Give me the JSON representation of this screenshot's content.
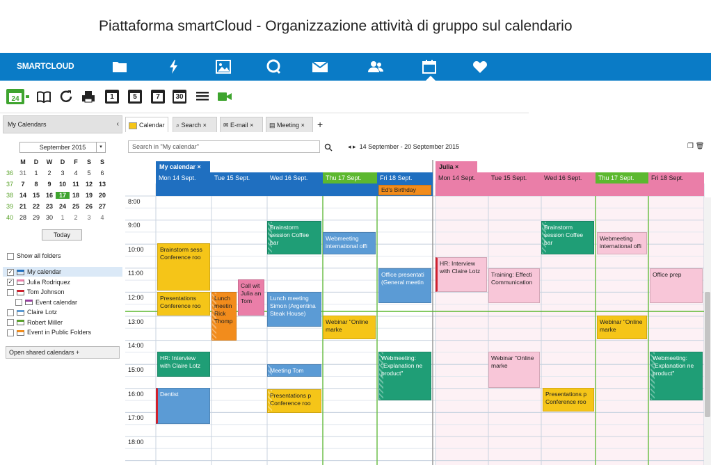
{
  "caption": "Piattaforma smartCloud - Organizzazione attività di gruppo sul calendario",
  "brand": {
    "logo": "SMARTCLOUD",
    "bar_color": "#0a7bc6"
  },
  "nav_icons": [
    "folder-icon",
    "lightning-icon",
    "image-icon",
    "chat-icon",
    "mail-icon",
    "people-icon",
    "calendar-icon",
    "heart-icon"
  ],
  "toolbar": {
    "new_day_label": "24",
    "day_label": "1",
    "workweek_label": "5",
    "week_label": "7",
    "month_label": "30"
  },
  "sidebar": {
    "title": "My Calendars",
    "collapse": "‹",
    "month": "September 2015",
    "weekday_headers": [
      "M",
      "D",
      "W",
      "D",
      "F",
      "S",
      "S"
    ],
    "weeks": [
      {
        "wk": "36",
        "days": [
          "31",
          "1",
          "2",
          "3",
          "4",
          "5",
          "6"
        ]
      },
      {
        "wk": "37",
        "days": [
          "7",
          "8",
          "9",
          "10",
          "11",
          "12",
          "13"
        ]
      },
      {
        "wk": "38",
        "days": [
          "14",
          "15",
          "16",
          "17",
          "18",
          "19",
          "20"
        ]
      },
      {
        "wk": "39",
        "days": [
          "21",
          "22",
          "23",
          "24",
          "25",
          "26",
          "27"
        ]
      },
      {
        "wk": "40",
        "days": [
          "28",
          "29",
          "30",
          "1",
          "2",
          "3",
          "4"
        ]
      }
    ],
    "today": "Today",
    "show_all": "Show all folders",
    "calendars": [
      {
        "label": "My calendar",
        "checked": true,
        "color": "#1f6fc0"
      },
      {
        "label": "Julia Rodriquez",
        "checked": true,
        "color": "#ea7ea8"
      },
      {
        "label": "Tom Johnson",
        "checked": false,
        "color": "#d0212e"
      },
      {
        "label": "Event calendar",
        "checked": false,
        "color": "#9a3fa0"
      },
      {
        "label": "Claire Lotz",
        "checked": false,
        "color": "#5b9bd5"
      },
      {
        "label": "Robert Miller",
        "checked": false,
        "color": "#5aa32a"
      },
      {
        "label": "Event in Public Folders",
        "checked": false,
        "color": "#f28c1c"
      }
    ],
    "shared": "Open shared calendars +"
  },
  "tabs": [
    {
      "label": "Calendar"
    },
    {
      "label": "Search",
      "close": "×"
    },
    {
      "label": "E-mail",
      "close": "×"
    },
    {
      "label": "Meeting",
      "close": "×"
    }
  ],
  "tab_add": "+",
  "search": {
    "placeholder": "Search in \"My calendar\""
  },
  "range": "14 September - 20 September 2015",
  "range_nav": "◂ ▸",
  "my_band": {
    "label": "My calendar",
    "close": "×"
  },
  "julia_band": {
    "label": "Julia",
    "close": "×"
  },
  "days": [
    "Mon 14 Sept.",
    "Tue 15 Sept.",
    "Wed 16 Sept.",
    "Thu 17 Sept.",
    "Fri 18 Sept."
  ],
  "hours": [
    "8:00",
    "9:00",
    "10:00",
    "11:00",
    "12:00",
    "13:00",
    "14:00",
    "15:00",
    "16:00",
    "17:00",
    "18:00"
  ],
  "allday_event": "Ed's Birthday",
  "events": {
    "my": [
      {
        "label": "Brainstorm session Coffee bar"
      },
      {
        "label": "Webmeeting international offi"
      },
      {
        "label": "Brainstorm sess Conference roo"
      },
      {
        "label": "Office presentati (General meetin"
      },
      {
        "label": "Call wit Julia an Tom"
      },
      {
        "label": "Presentations Conference roo"
      },
      {
        "label": "Lunch meetin Rick Thomp"
      },
      {
        "label": "Lunch meeting Simon (Argentina Steak House)"
      },
      {
        "label": "Webinar \"Online marke"
      },
      {
        "label": "HR: Interview with Claire Lotz"
      },
      {
        "label": "Webmeeting: \"Explanation ne product\""
      },
      {
        "label": "Meeting Tom"
      },
      {
        "label": "Dentist"
      },
      {
        "label": "Presentations p Conference roo"
      }
    ],
    "julia": [
      {
        "label": "Brainstorm session Coffee bar"
      },
      {
        "label": "Webmeeting international offi"
      },
      {
        "label": "HR: Interview with Claire Lotz"
      },
      {
        "label": "Training: Effecti Communication"
      },
      {
        "label": "Office prep"
      },
      {
        "label": "Webinar \"Online marke"
      },
      {
        "label": "Webinar \"Online marke"
      },
      {
        "label": "Webmeeting: \"Explanation ne product\""
      },
      {
        "label": "Presentations p Conference roo"
      }
    ]
  }
}
